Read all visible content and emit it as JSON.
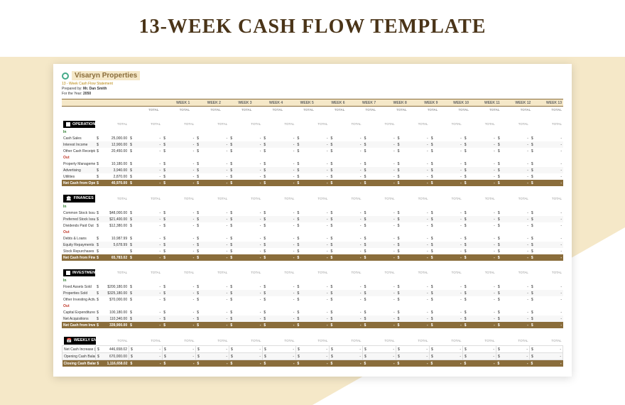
{
  "title": "13-WEEK CASH FLOW TEMPLATE",
  "brand": "Visaryn Properties",
  "subtitle": "13 - Week Cash Flow Statement",
  "prepared_label": "Prepared by:",
  "prepared_by": "Mr. Dan Smith",
  "year_label": "For the Year:",
  "year": "2050",
  "weeks": [
    "WEEK 1",
    "WEEK 2",
    "WEEK 3",
    "WEEK 4",
    "WEEK 5",
    "WEEK 6",
    "WEEK 7",
    "WEEK 8",
    "WEEK 9",
    "WEEK 10",
    "WEEK 11",
    "WEEK 12",
    "WEEK 13"
  ],
  "total_label": "TOTAL",
  "in_label": "In",
  "out_label": "Out",
  "sections": {
    "ops": {
      "title": "OPERATIONS",
      "in_rows": [
        {
          "label": "Cash Sales",
          "val": "25,000.00"
        },
        {
          "label": "Interest Income",
          "val": "12,900.00"
        },
        {
          "label": "Other Cash Receipts",
          "val": "20,450.00"
        }
      ],
      "out_rows": [
        {
          "label": "Property Management",
          "val": "10,180.00"
        },
        {
          "label": "Advertising",
          "val": "3,940.00"
        },
        {
          "label": "Utilities",
          "val": "2,870.00"
        }
      ],
      "net_label": "Net Cash from Operations",
      "net_val": "40,970.00"
    },
    "fin": {
      "title": "FINANCES",
      "in_rows": [
        {
          "label": "Common Stock Issuance",
          "val": "$48,000.00"
        },
        {
          "label": "Preferred Stock Issuance",
          "val": "$21,400.00"
        },
        {
          "label": "Dividends Paid Out",
          "val": "$12,380.00"
        }
      ],
      "out_rows": [
        {
          "label": "Debts & Loans",
          "val": "10,987.99"
        },
        {
          "label": "Equity Repayments",
          "val": "5,678.99"
        },
        {
          "label": "Stock Repurchases",
          "val": ""
        }
      ],
      "net_label": "Net Cash from Finances",
      "net_val": "65,783.02"
    },
    "inv": {
      "title": "INVESTMENTS",
      "in_rows": [
        {
          "label": "Fixed Assets Sold",
          "val": "$200,180.00"
        },
        {
          "label": "Properties Sold",
          "val": "$325,180.00"
        },
        {
          "label": "Other Investing Activities",
          "val": "$70,000.00"
        }
      ],
      "out_rows": [
        {
          "label": "Capital Expenditures",
          "val": "100,180.00"
        },
        {
          "label": "Net Acquisitions",
          "val": "110,340.00"
        }
      ],
      "net_label": "Net Cash from Investments",
      "net_val": "339,900.00"
    },
    "ending": {
      "title": "WEEKLY ENDING",
      "rows": [
        {
          "label": "Net Cash Increase (Decrease)",
          "val": "446,658.02"
        },
        {
          "label": "Opening Cash Balance",
          "val": "670,000.00"
        }
      ],
      "close_label": "Closing Cash Balance",
      "close_val": "1,116,658.02"
    }
  },
  "dash": "-",
  "dollar": "$"
}
